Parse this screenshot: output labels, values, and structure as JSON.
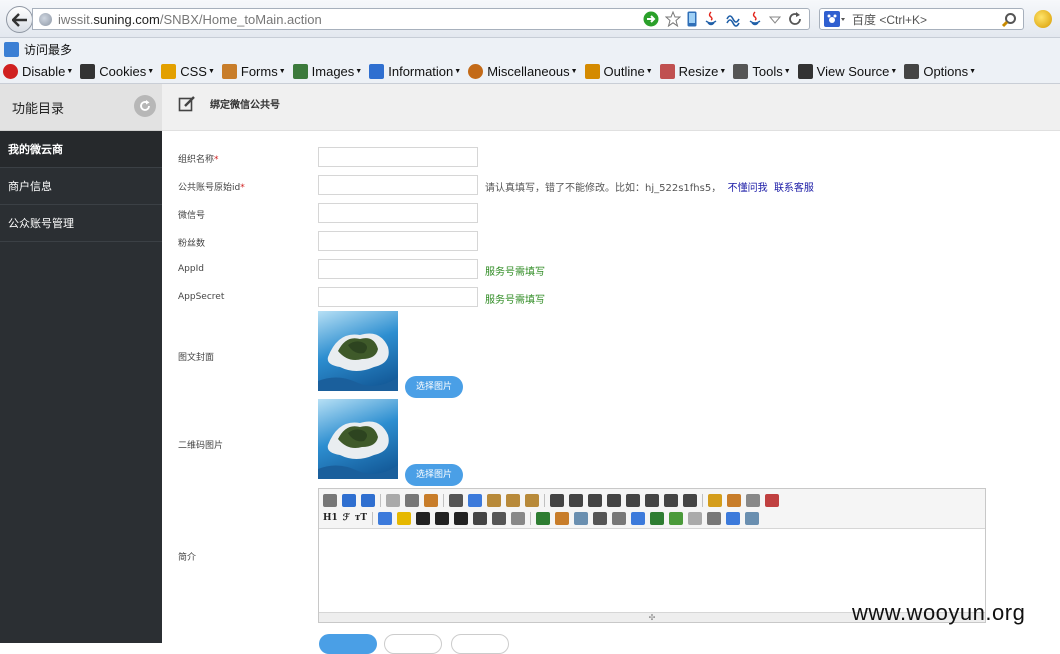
{
  "browser": {
    "url_prefix": "iwssit.",
    "url_domain": "suning.com",
    "url_path": "/SNBX/Home_toMain.action",
    "search_placeholder": "百度 <Ctrl+K>",
    "bookmark_label": "访问最多",
    "toolbar": [
      "Disable",
      "Cookies",
      "CSS",
      "Forms",
      "Images",
      "Information",
      "Miscellaneous",
      "Outline",
      "Resize",
      "Tools",
      "View Source",
      "Options"
    ]
  },
  "sidebar": {
    "title": "功能目录",
    "items": [
      {
        "label": "我的微云商"
      },
      {
        "label": "商户信息"
      },
      {
        "label": "公众账号管理"
      }
    ]
  },
  "page": {
    "title": "绑定微信公共号"
  },
  "form": {
    "org_name": "组织名称",
    "public_id": "公共账号原始id",
    "public_id_hint": "请认真填写，错了不能修改。比如：hj_522s1fhs5，",
    "dont_know": "不懂问我",
    "contact": "联系客服",
    "wechat": "微信号",
    "fans": "粉丝数",
    "appid": "AppId",
    "appsecret": "AppSecret",
    "service_hint": "服务号需填写",
    "cover": "图文封面",
    "qrcode": "二维码图片",
    "select_image": "选择图片",
    "intro": "简介",
    "required_mark": "*"
  },
  "editor": {
    "row1_text": [
      "ABC"
    ],
    "heading": "H1",
    "font": "ℱ",
    "size": "тT"
  },
  "watermark": "www.wooyun.org",
  "colors": {
    "sidebar_bg": "#2b2f33",
    "accent_blue": "#4a9fe6",
    "hint_green": "#2e8b22",
    "link_blue": "#1a1aa6",
    "required_red": "#d02020"
  }
}
